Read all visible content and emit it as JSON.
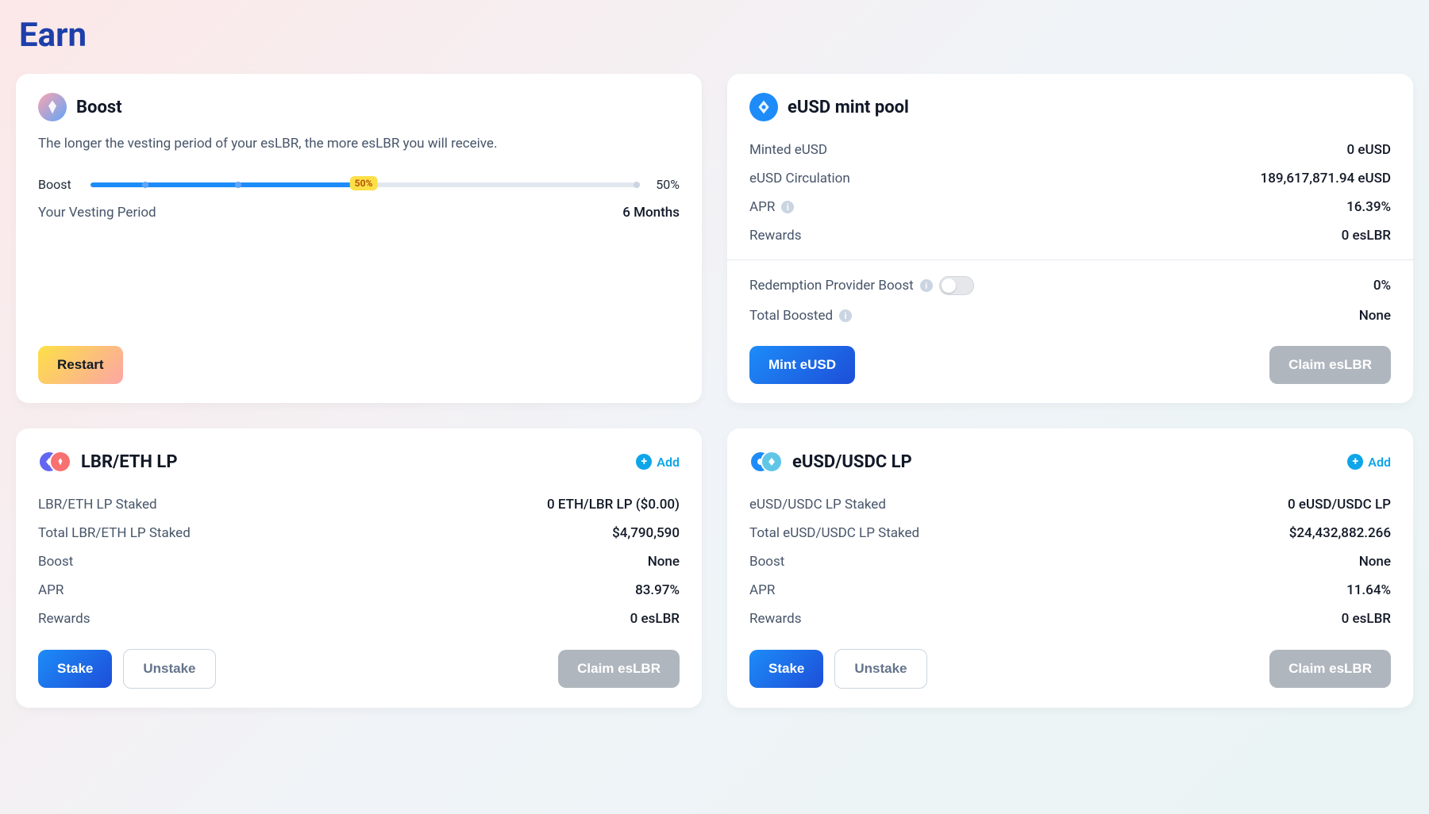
{
  "pageTitle": "Earn",
  "boost": {
    "title": "Boost",
    "description": "The longer the vesting period of your esLBR, the more esLBR you will receive.",
    "boostLabel": "Boost",
    "boostPercentDisplay": "50%",
    "sliderBadge": "50%",
    "vestingLabel": "Your Vesting Period",
    "vestingValue": "6 Months",
    "restartLabel": "Restart"
  },
  "eusdPool": {
    "title": "eUSD mint pool",
    "mintedLabel": "Minted eUSD",
    "mintedValue": "0 eUSD",
    "circulationLabel": "eUSD Circulation",
    "circulationValue": "189,617,871.94 eUSD",
    "aprLabel": "APR",
    "aprValue": "16.39%",
    "rewardsLabel": "Rewards",
    "rewardsValue": "0 esLBR",
    "redemptionLabel": "Redemption Provider Boost",
    "redemptionValue": "0%",
    "totalBoostedLabel": "Total Boosted",
    "totalBoostedValue": "None",
    "mintButton": "Mint eUSD",
    "claimButton": "Claim esLBR"
  },
  "lbrEthLp": {
    "title": "LBR/ETH LP",
    "addLabel": "Add",
    "stakedLabel": "LBR/ETH LP Staked",
    "stakedValue": "0 ETH/LBR LP ($0.00)",
    "totalStakedLabel": "Total LBR/ETH LP Staked",
    "totalStakedValue": "$4,790,590",
    "boostLabel": "Boost",
    "boostValue": "None",
    "aprLabel": "APR",
    "aprValue": "83.97%",
    "rewardsLabel": "Rewards",
    "rewardsValue": "0 esLBR",
    "stakeButton": "Stake",
    "unstakeButton": "Unstake",
    "claimButton": "Claim esLBR"
  },
  "eusdUsdcLp": {
    "title": "eUSD/USDC LP",
    "addLabel": "Add",
    "stakedLabel": "eUSD/USDC LP Staked",
    "stakedValue": "0 eUSD/USDC LP",
    "totalStakedLabel": "Total eUSD/USDC LP Staked",
    "totalStakedValue": "$24,432,882.266",
    "boostLabel": "Boost",
    "boostValue": "None",
    "aprLabel": "APR",
    "aprValue": "11.64%",
    "rewardsLabel": "Rewards",
    "rewardsValue": "0 esLBR",
    "stakeButton": "Stake",
    "unstakeButton": "Unstake",
    "claimButton": "Claim esLBR"
  }
}
